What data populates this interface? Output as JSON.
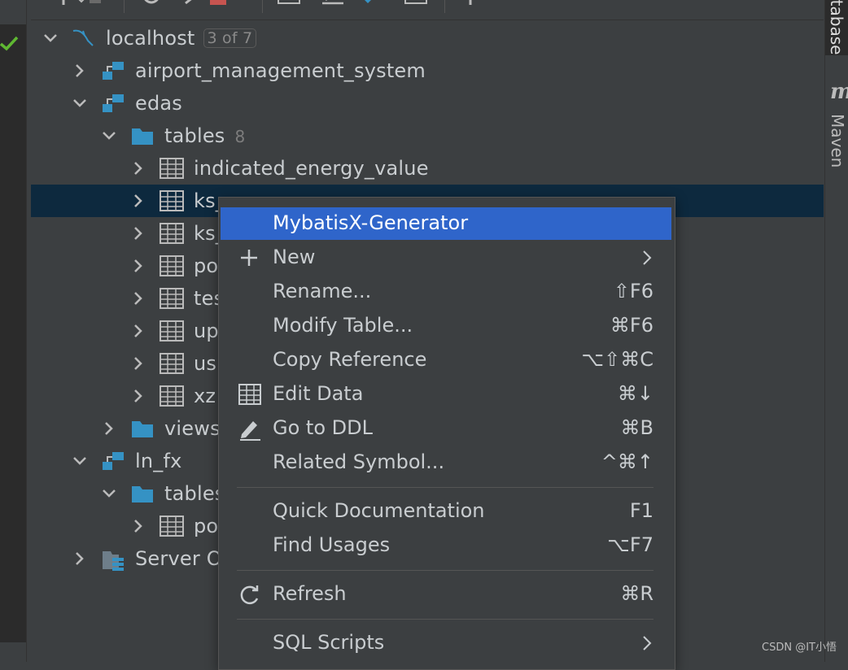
{
  "tree": {
    "root": {
      "label": "localhost",
      "badge": "3 of 7"
    },
    "items": [
      {
        "label": "airport_management_system"
      },
      {
        "label": "edas"
      },
      {
        "label": "tables",
        "count": "8"
      },
      {
        "label": "indicated_energy_value"
      },
      {
        "label": "ks_"
      },
      {
        "label": "ks_"
      },
      {
        "label": "po"
      },
      {
        "label": "tes"
      },
      {
        "label": "up"
      },
      {
        "label": "us"
      },
      {
        "label": "xz"
      },
      {
        "label": "views"
      },
      {
        "label": "ln_fx"
      },
      {
        "label": "tables"
      },
      {
        "label": "po"
      },
      {
        "label": "Server O"
      }
    ]
  },
  "context_menu": {
    "items": [
      {
        "label": "MybatisX-Generator",
        "shortcut": ""
      },
      {
        "label": "New",
        "shortcut": ""
      },
      {
        "label": "Rename...",
        "shortcut": "⇧F6"
      },
      {
        "label": "Modify Table...",
        "shortcut": "⌘F6"
      },
      {
        "label": "Copy Reference",
        "shortcut": "⌥⇧⌘C"
      },
      {
        "label": "Edit Data",
        "shortcut": "⌘↓"
      },
      {
        "label": "Go to DDL",
        "shortcut": "⌘B"
      },
      {
        "label": "Related Symbol...",
        "shortcut": "^⌘↑"
      },
      {
        "label": "Quick Documentation",
        "shortcut": "F1"
      },
      {
        "label": "Find Usages",
        "shortcut": "⌥F7"
      },
      {
        "label": "Refresh",
        "shortcut": "⌘R"
      },
      {
        "label": "SQL Scripts",
        "shortcut": ""
      }
    ]
  },
  "side_tabs": {
    "database": "Database",
    "maven": "Maven",
    "maven_logo": "m"
  },
  "watermark": "CSDN @IT小悟",
  "colors": {
    "selection": "#0d293e",
    "menu_highlight": "#2f65ca",
    "db_icon": "#3592c4",
    "folder": "#3592c4"
  }
}
